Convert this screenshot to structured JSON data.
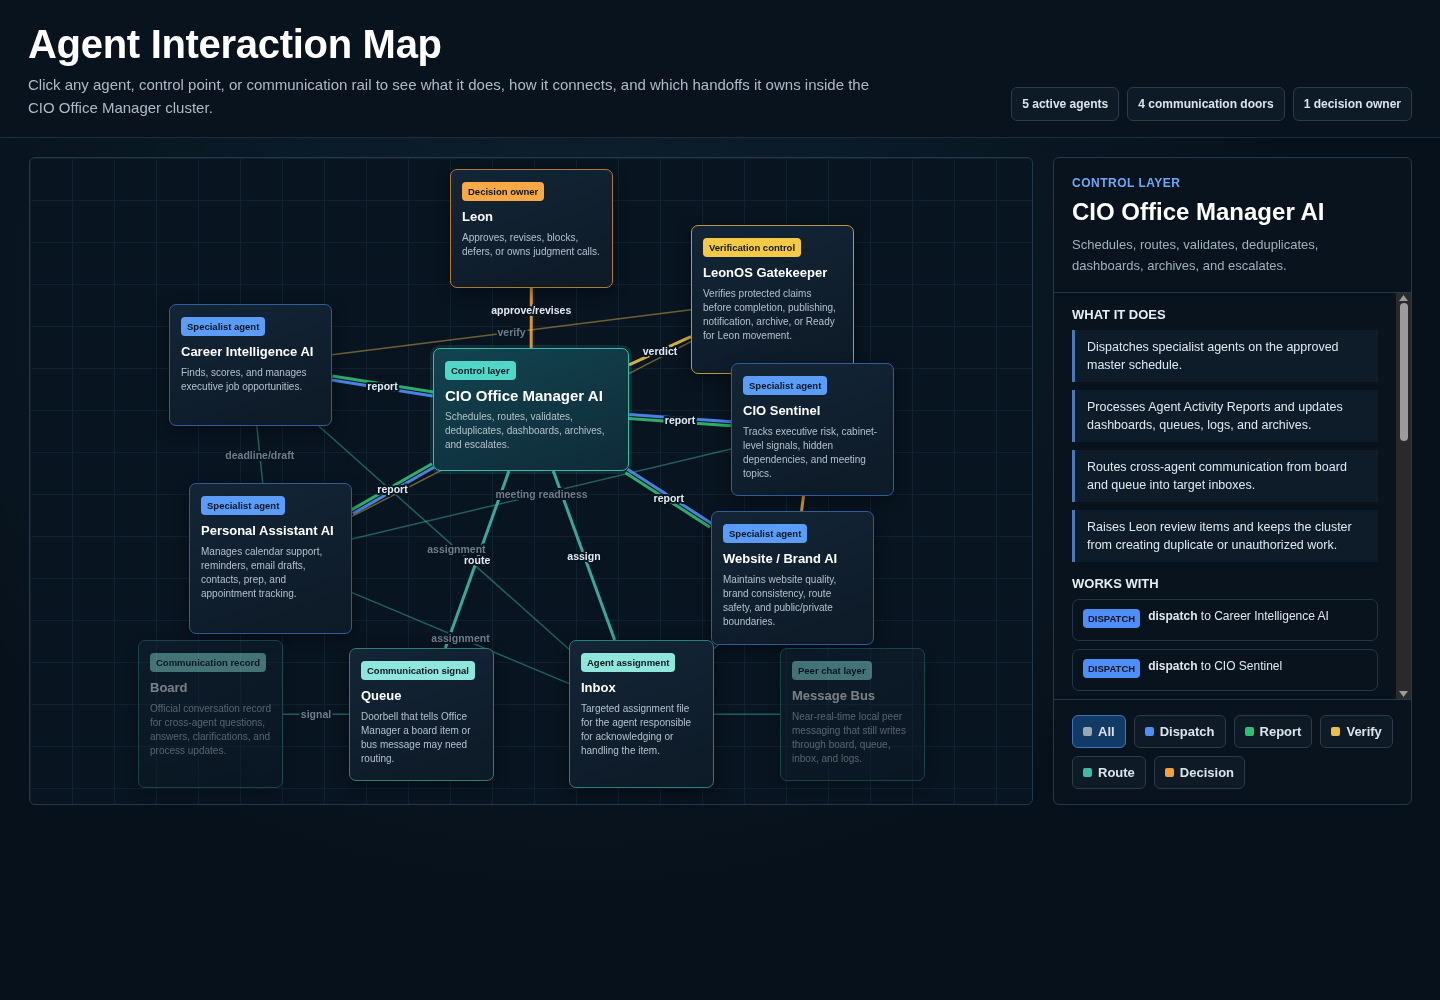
{
  "header": {
    "title": "Agent Interaction Map",
    "subtitle": "Click any agent, control point, or communication rail to see what it does, how it connects, and which handoffs it owns inside the CIO Office Manager cluster.",
    "stats": [
      "5 active agents",
      "4 communication doors",
      "1 decision owner"
    ]
  },
  "map": {
    "nodes": [
      {
        "kind": "decision",
        "tag": "Decision owner",
        "title": "Leon",
        "text": "Approves, revises, blocks, defers, or owns judgment calls.",
        "selected": false,
        "dim": false
      },
      {
        "kind": "verification",
        "tag": "Verification control",
        "title": "LeonOS Gatekeeper",
        "text": "Verifies protected claims before completion, publishing, notification, archive, or Ready for Leon movement.",
        "selected": false,
        "dim": false
      },
      {
        "kind": "specialist",
        "tag": "Specialist agent",
        "title": "Career Intelligence AI",
        "text": "Finds, scores, and manages executive job opportunities.",
        "selected": false,
        "dim": false
      },
      {
        "kind": "control",
        "tag": "Control layer",
        "title": "CIO Office Manager AI",
        "text": "Schedules, routes, validates, deduplicates, dashboards, archives, and escalates.",
        "selected": true,
        "dim": false
      },
      {
        "kind": "specialist",
        "tag": "Specialist agent",
        "title": "CIO Sentinel",
        "text": "Tracks executive risk, cabinet-level signals, hidden dependencies, and meeting topics.",
        "selected": false,
        "dim": false
      },
      {
        "kind": "specialist",
        "tag": "Specialist agent",
        "title": "Personal Assistant AI",
        "text": "Manages calendar support, reminders, email drafts, contacts, prep, and appointment tracking.",
        "selected": false,
        "dim": false
      },
      {
        "kind": "specialist",
        "tag": "Specialist agent",
        "title": "Website / Brand AI",
        "text": "Maintains website quality, brand consistency, route safety, and public/private boundaries.",
        "selected": false,
        "dim": false
      },
      {
        "kind": "channel",
        "tag": "Communication record",
        "title": "Board",
        "text": "Official conversation record for cross-agent questions, answers, clarifications, and process updates.",
        "selected": false,
        "dim": true
      },
      {
        "kind": "channel",
        "tag": "Communication signal",
        "title": "Queue",
        "text": "Doorbell that tells Office Manager a board item or bus message may need routing.",
        "selected": false,
        "dim": false
      },
      {
        "kind": "channel",
        "tag": "Agent assignment",
        "title": "Inbox",
        "text": "Targeted assignment file for the agent responsible for acknowledging or handling the item.",
        "selected": false,
        "dim": false
      },
      {
        "kind": "channel",
        "tag": "Peer chat layer",
        "title": "Message Bus",
        "text": "Near-real-time local peer messaging that still writes through board, queue, inbox, and logs.",
        "selected": false,
        "dim": true
      }
    ],
    "edges": [
      {
        "kind": "decision",
        "label": "approve/revises",
        "dim": false
      },
      {
        "kind": "verify",
        "label": "verify",
        "dim": true
      },
      {
        "kind": "verify",
        "label": "verdict",
        "dim": false
      },
      {
        "kind": "dispatch",
        "dim": false
      },
      {
        "kind": "report",
        "label": "report",
        "dim": false
      },
      {
        "kind": "dispatch",
        "dim": false
      },
      {
        "kind": "report",
        "label": "report",
        "dim": false
      },
      {
        "kind": "dispatch",
        "dim": false
      },
      {
        "kind": "report",
        "label": "report",
        "dim": false
      },
      {
        "kind": "dispatch",
        "dim": false
      },
      {
        "kind": "report",
        "label": "report",
        "dim": false
      },
      {
        "kind": "route",
        "label": "deadline/draft",
        "dim": true
      },
      {
        "kind": "route",
        "label": "assign",
        "dim": false
      },
      {
        "kind": "route",
        "label": "route",
        "dim": false
      },
      {
        "kind": "route",
        "label": "meeting readiness",
        "dim": true
      },
      {
        "kind": "route",
        "label": "assignment",
        "dim": true
      },
      {
        "kind": "route",
        "label": "assignment",
        "dim": true
      },
      {
        "kind": "route",
        "label": "signal",
        "dim": true
      },
      {
        "kind": "route",
        "dim": true
      },
      {
        "kind": "decision",
        "dim": false
      },
      {
        "kind": "route",
        "dim": true
      },
      {
        "kind": "verify",
        "dim": true
      }
    ]
  },
  "panel": {
    "eyebrow": "CONTROL LAYER",
    "title": "CIO Office Manager AI",
    "description": "Schedules, routes, validates, deduplicates, dashboards, archives, and escalates.",
    "does_heading": "WHAT IT DOES",
    "does": [
      "Dispatches specialist agents on the approved master schedule.",
      "Processes Agent Activity Reports and updates dashboards, queues, logs, and archives.",
      "Routes cross-agent communication from board and queue into target inboxes.",
      "Raises Leon review items and keeps the cluster from creating duplicate or unauthorized work."
    ],
    "works_heading": "WORKS WITH",
    "works_with": [
      {
        "kind": "dispatch",
        "badge": "DISPATCH",
        "text": "**dispatch** to Career Intelligence AI"
      },
      {
        "kind": "dispatch",
        "badge": "DISPATCH",
        "text": "**dispatch** to CIO Sentinel"
      }
    ],
    "filters": [
      {
        "kind": "all",
        "label": "All",
        "selected": true
      },
      {
        "kind": "dispatch",
        "label": "Dispatch",
        "selected": false
      },
      {
        "kind": "report",
        "label": "Report",
        "selected": false
      },
      {
        "kind": "verify",
        "label": "Verify",
        "selected": false
      },
      {
        "kind": "route",
        "label": "Route",
        "selected": false
      },
      {
        "kind": "decision",
        "label": "Decision",
        "selected": false
      }
    ]
  }
}
